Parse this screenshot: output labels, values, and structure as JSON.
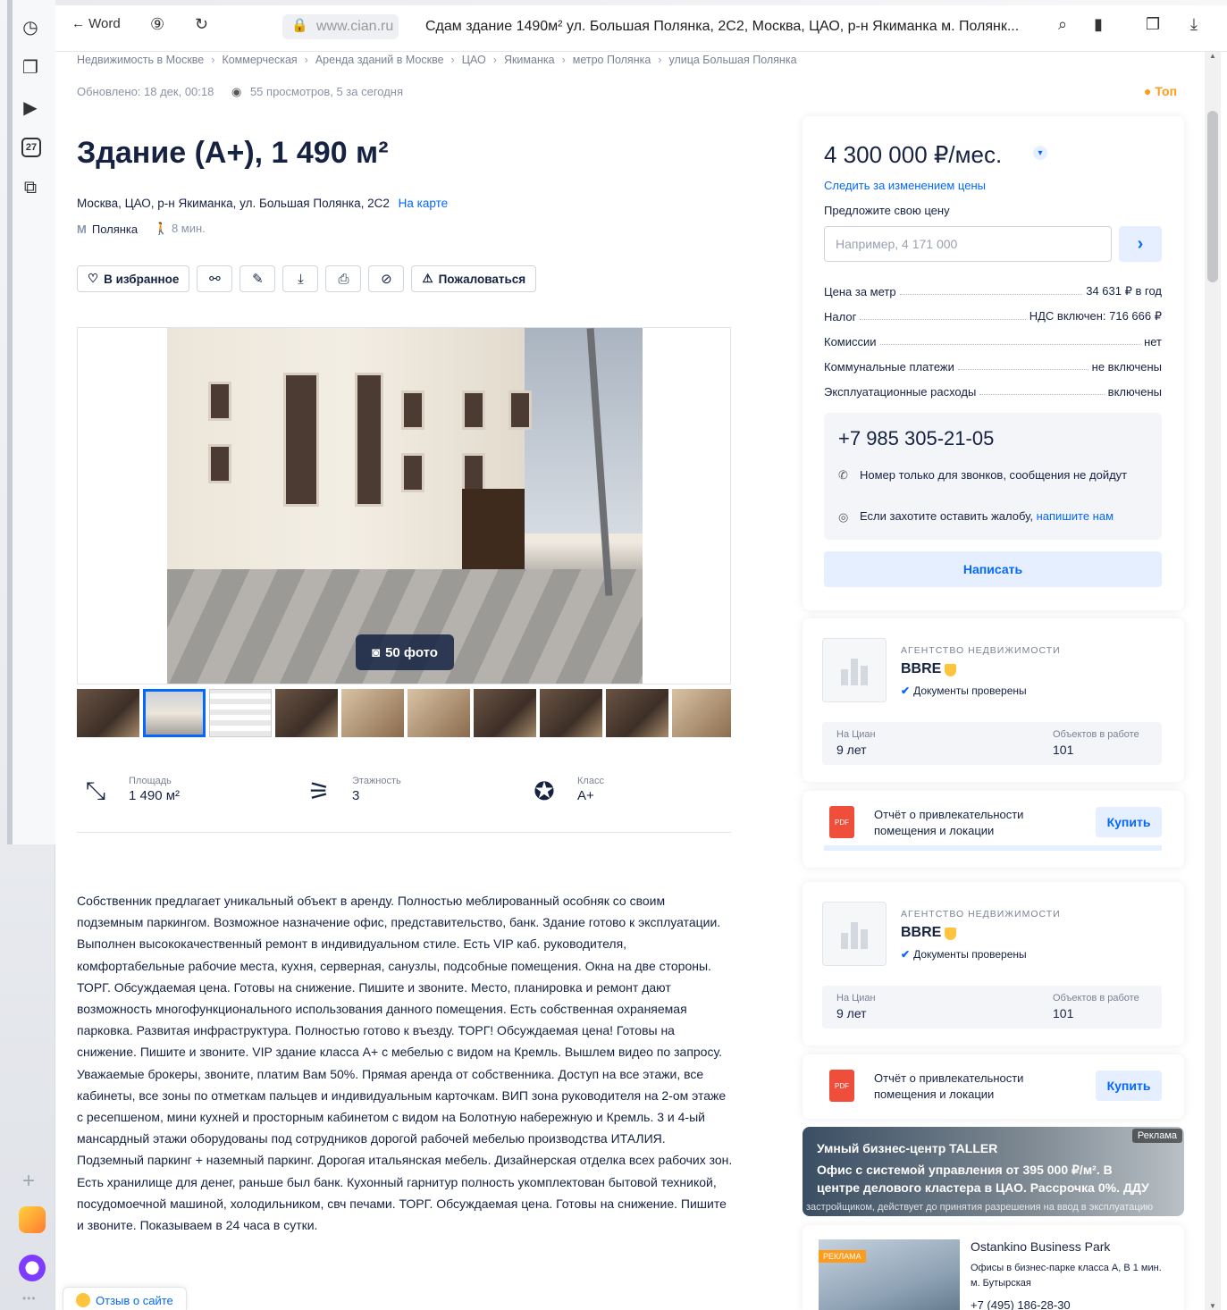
{
  "browser": {
    "back_label": "← Word",
    "domain": "www.cian.ru",
    "tab_title": "Сдам здание 1490м² ул. Большая Полянка, 2С2, Москва, ЦАО, р-н Якиманка м. Полянк...",
    "rail_calendar_day": "27"
  },
  "breadcrumbs": [
    "Недвижимость в Москве",
    "Коммерческая",
    "Аренда зданий в Москве",
    "ЦАО",
    "Якиманка",
    "метро Полянка",
    "улица Большая Полянка"
  ],
  "meta": {
    "updated": "Обновлено: 18 дек, 00:18",
    "views": "55 просмотров, 5 за сегодня",
    "top_label": "Топ"
  },
  "listing": {
    "title": "Здание (A+), 1 490 м²",
    "address": "Москва, ЦАО, р-н Якиманка, ул. Большая Полянка, 2С2",
    "map_link": "На карте",
    "metro": "Полянка",
    "walk": "8 мин."
  },
  "actions": {
    "favorite": "В избранное",
    "complain": "Пожаловаться"
  },
  "gallery": {
    "photo_count": "50 фото"
  },
  "features": [
    {
      "label": "Площадь",
      "value": "1 490 м²",
      "icon": "area-icon"
    },
    {
      "label": "Этажность",
      "value": "3",
      "icon": "stairs-icon"
    },
    {
      "label": "Класс",
      "value": "A+",
      "icon": "star-icon"
    }
  ],
  "description": "Собственник предлагает уникальный объект в аренду. Полностью меблированный особняк со своим подземным паркингом. Возможное назначение офис, представительство, банк. Здание готово к эксплуатации. Выполнен высококачественный ремонт в индивидуальном стиле. Есть VIP каб. руководителя, комфортабельные рабочие места, кухня, серверная, санузлы, подсобные помещения. Окна на две стороны. ТОРГ. Обсуждаемая цена. Готовы на снижение. Пишите и звоните. Место, планировка и ремонт дают возможность многофункционального использования данного помещения. Есть собственная охраняемая парковка. Развитая инфраструктура. Полностью готово к въезду. ТОРГ! Обсуждаемая цена! Готовы на снижение. Пишите и звоните. VIP здание класса А+ с мебелью с видом на Кремль. Вышлем видео по запросу. Уважаемые брокеры, звоните, платим Вам 50%. Прямая аренда от собственника. Доступ на все этажи, все кабинеты, все зоны по отметкам пальцев и индивидуальным карточкам. ВИП зона руководителя на 2-ом этаже с ресепшеном, мини кухней и просторным кабинетом с видом на Болотную набережную и Кремль. 3 и 4-ый мансардный этажи оборудованы под сотрудников дорогой рабочей мебелью производства ИТАЛИЯ. Подземный паркинг + наземный паркинг. Дорогая итальянская мебель. Дизайнерская отделка всех рабочих зон. Есть хранилище для денег, раньше был банк. Кухонный гарнитур полность укомплектован бытовой техникой, посудомоечной машиной, холодильником, свч печами. ТОРГ. Обсуждаемая цена. Готовы на снижение. Пишите и звоните. Показываем в 24 часа в сутки.",
  "reviews_tab": "Отзыв о сайте",
  "price_card": {
    "price": "4 300 000 ₽/мес.",
    "follow": "Следить за изменением цены",
    "offer_label": "Предложите свою цену",
    "offer_placeholder": "Например, 4 171 000",
    "rows": [
      {
        "label": "Цена за метр",
        "value": "34 631 ₽ в год"
      },
      {
        "label": "Налог",
        "value": "НДС включен: 716 666 ₽"
      },
      {
        "label": "Комиссии",
        "value": "нет"
      },
      {
        "label": "Коммунальные платежи",
        "value": "не включены"
      },
      {
        "label": "Эксплуатационные расходы",
        "value": "включены"
      }
    ],
    "phone": "+7 985 305-21-05",
    "calls_note": "Номер только для звонков, сообщения не дойдут",
    "complain_note": "Если захотите оставить жалобу,",
    "complain_link": "напишите нам",
    "write_button": "Написать"
  },
  "agencies": [
    {
      "kind": "АГЕНТСТВО НЕДВИЖИМОСТИ",
      "name": "BBRE",
      "docs": "Документы проверены",
      "years_label": "На Циан",
      "years_value": "9 лет",
      "objects_label": "Объектов в работе",
      "objects_value": "101"
    },
    {
      "kind": "АГЕНТСТВО НЕДВИЖИМОСТИ",
      "name": "BBRE",
      "docs": "Документы проверены",
      "years_label": "На Циан",
      "years_value": "9 лет",
      "objects_label": "Объектов в работе",
      "objects_value": "101"
    }
  ],
  "reports": [
    {
      "title": "Отчёт о привлекательности помещения и локации",
      "buy": "Купить"
    },
    {
      "title": "Отчёт о привлекательности помещения и локации",
      "buy": "Купить"
    }
  ],
  "ad_banner": {
    "tag": "Реклама",
    "line1": "Умный бизнес-центр TALLER",
    "line2": "Офис с системой управления от 395 000 ₽/м². В центре делового кластера в ЦАО. Рассрочка 0%. ДДУ",
    "line3": "застройщиком, действует до принятия разрешения на ввод в эксплуатацию"
  },
  "ad_card": {
    "label": "РЕКЛАМА",
    "name": "Ostankino Business Park",
    "desc": "Офисы в бизнес-парке класса A, B 1 мин. м. Бутырская",
    "phone": "+7 (495) 186-28-30"
  },
  "colors": {
    "accent": "#0468ff",
    "text": "#152242",
    "muted": "#7a8294",
    "top_badge": "#ff9b1a"
  }
}
